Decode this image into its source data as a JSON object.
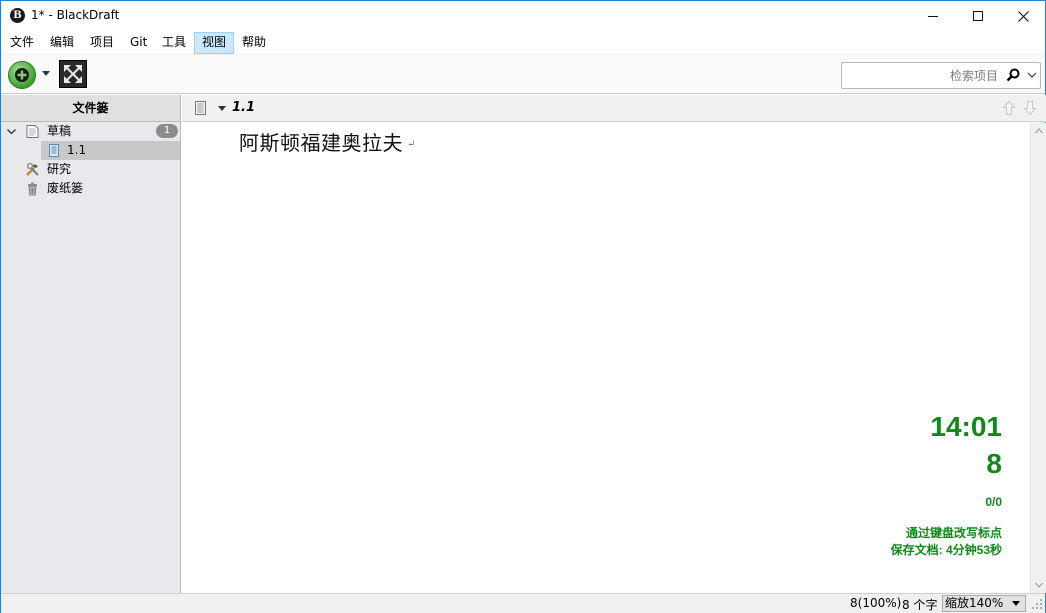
{
  "window": {
    "title": "1* - BlackDraft",
    "app_icon_letter": "B"
  },
  "menu": [
    "文件",
    "编辑",
    "项目",
    "Git",
    "工具",
    "视图",
    "帮助"
  ],
  "menu_active_index": 5,
  "toolbar": {
    "search_placeholder": "检索项目"
  },
  "binder": {
    "header": "文件篓",
    "items": [
      {
        "label": "草稿",
        "icon": "draft-folder-icon",
        "expanded": true,
        "badge": "1"
      },
      {
        "label": "1.1",
        "icon": "document-icon",
        "selected": true
      },
      {
        "label": "研究",
        "icon": "research-tools-icon"
      },
      {
        "label": "废纸篓",
        "icon": "trash-icon"
      }
    ]
  },
  "editor": {
    "header_title": "1.1",
    "text": "阿斯顿福建奥拉夫",
    "pilcrow": "↵"
  },
  "stats": {
    "time": "14:01",
    "word_count": "8",
    "progress": "0/0",
    "mode": "通过键盘改写标点",
    "save": "保存文档: 4分钟53秒"
  },
  "statusbar": {
    "words": "8(100%)",
    "chars": "8 个字",
    "zoom": "缩放140%"
  },
  "colors": {
    "stats_green": "#0f8a17",
    "window_border": "#1883d7",
    "menu_active_bg": "#cce8ff"
  }
}
